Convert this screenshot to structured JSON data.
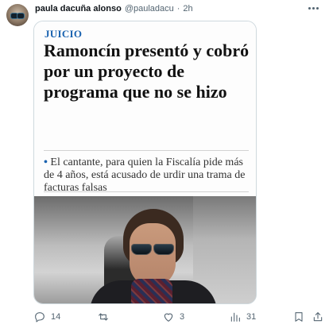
{
  "tweet": {
    "author_name": "paula dacuña alonso",
    "handle": "@pauladacu",
    "separator": "·",
    "time": "2h"
  },
  "article": {
    "section": "JUICIO",
    "headline": "Ramoncín presentó y cobró por un proyecto de programa que no se hizo",
    "lead_bullet": "•",
    "lead": "El cantante, para quien la Fiscalía pide más de 4 años, está acusado de urdir una trama de facturas falsas"
  },
  "actions": {
    "replies": "14",
    "retweets": "",
    "likes": "3",
    "views": "31"
  },
  "icons": {
    "reply": "reply-icon",
    "retweet": "retweet-icon",
    "like": "heart-icon",
    "views": "views-bar-chart-icon",
    "bookmark": "bookmark-icon",
    "share": "share-icon",
    "more": "more-dots-icon"
  },
  "colors": {
    "section_accent": "#1a63b0",
    "secondary_text": "#536471",
    "card_border": "#cfd9de"
  }
}
